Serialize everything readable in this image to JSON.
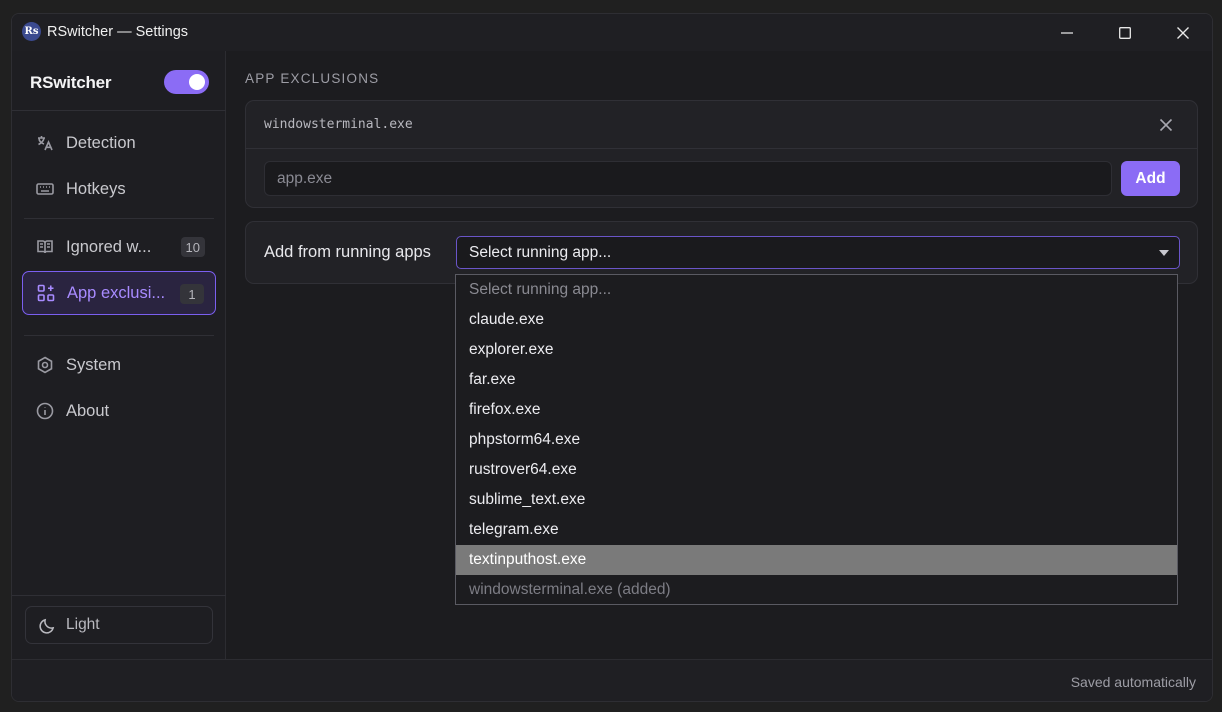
{
  "window": {
    "icon_text": "Rs",
    "title": "RSwitcher — Settings"
  },
  "sidebar": {
    "brand": "RSwitcher",
    "enabled": true,
    "items": [
      {
        "label": "Detection",
        "icon": "translate-icon"
      },
      {
        "label": "Hotkeys",
        "icon": "keyboard-icon"
      },
      {
        "label": "Ignored w...",
        "icon": "book-icon",
        "badge": "10"
      },
      {
        "label": "App exclusi...",
        "icon": "apps-add-icon",
        "badge": "1",
        "active": true
      },
      {
        "label": "System",
        "icon": "hexagon-gear-icon"
      },
      {
        "label": "About",
        "icon": "info-icon"
      }
    ],
    "theme_button": "Light"
  },
  "main": {
    "section_title": "APP EXCLUSIONS",
    "exclusions": [
      "windowsterminal.exe"
    ],
    "input": {
      "value": "",
      "placeholder": "app.exe"
    },
    "add_button": "Add",
    "running_apps_label": "Add from running apps",
    "select_value": "Select running app...",
    "dropdown_options": [
      {
        "label": "Select running app...",
        "state": "placeholder"
      },
      {
        "label": "claude.exe"
      },
      {
        "label": "explorer.exe"
      },
      {
        "label": "far.exe"
      },
      {
        "label": "firefox.exe"
      },
      {
        "label": "phpstorm64.exe"
      },
      {
        "label": "rustrover64.exe"
      },
      {
        "label": "sublime_text.exe"
      },
      {
        "label": "telegram.exe"
      },
      {
        "label": "textinputhost.exe",
        "state": "highlighted"
      },
      {
        "label": "windowsterminal.exe (added)",
        "state": "disabled"
      }
    ]
  },
  "footer": {
    "status": "Saved automatically"
  },
  "colors": {
    "accent": "#8b6cf5",
    "accent_text": "#a88bff",
    "background": "#1c1c1f",
    "highlight": "#7a7a7a"
  }
}
